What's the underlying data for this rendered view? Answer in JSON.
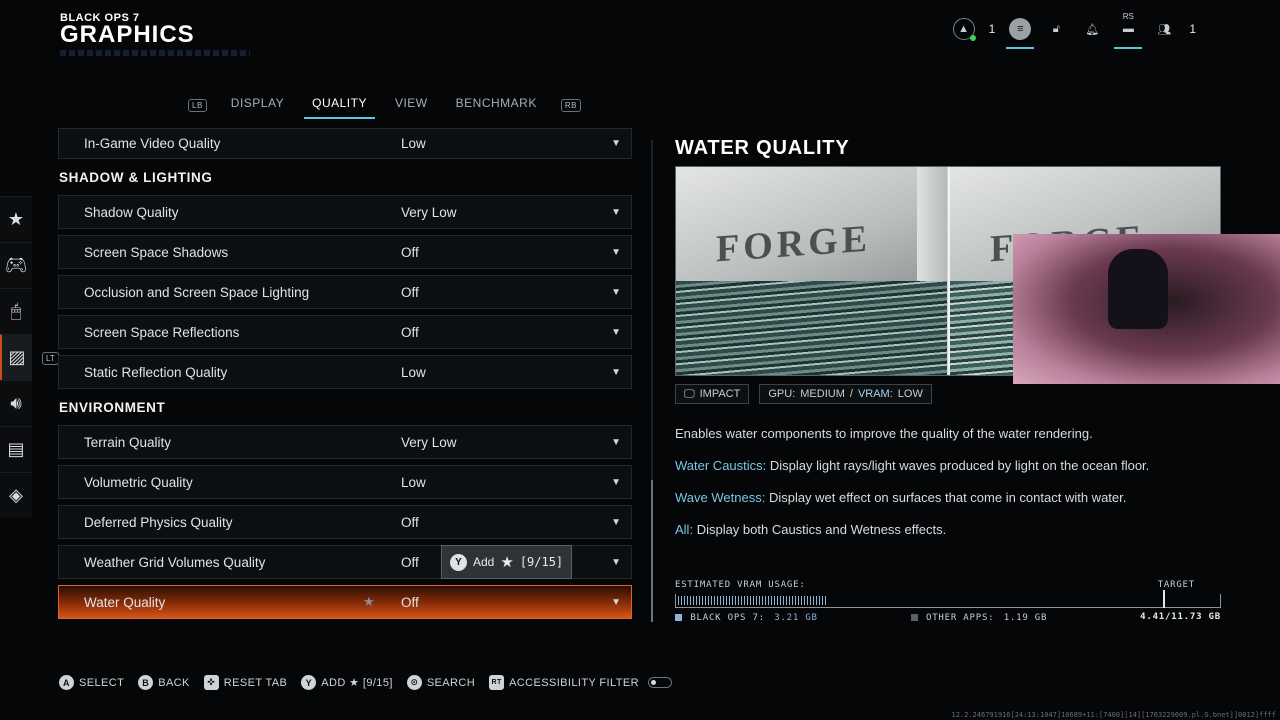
{
  "header": {
    "logo_small": "BLACK OPS 7",
    "title": "GRAPHICS"
  },
  "top_icons": [
    {
      "name": "friends-icon",
      "count": "1"
    },
    {
      "name": "menu-icon"
    },
    {
      "name": "lock-icon"
    },
    {
      "name": "bell-icon"
    },
    {
      "name": "rs-icon",
      "label": "RS"
    },
    {
      "name": "party-icon",
      "count": "1"
    }
  ],
  "tabs": {
    "lb": "LB",
    "rb": "RB",
    "items": [
      "DISPLAY",
      "QUALITY",
      "VIEW",
      "BENCHMARK"
    ],
    "active": "QUALITY"
  },
  "sidebar": {
    "lt": "LT"
  },
  "settings": {
    "top_row": {
      "label": "In-Game Video Quality",
      "value": "Low"
    },
    "sections": [
      {
        "title": "SHADOW & LIGHTING",
        "rows": [
          {
            "label": "Shadow Quality",
            "value": "Very Low"
          },
          {
            "label": "Screen Space Shadows",
            "value": "Off"
          },
          {
            "label": "Occlusion and Screen Space Lighting",
            "value": "Off"
          },
          {
            "label": "Screen Space Reflections",
            "value": "Off"
          },
          {
            "label": "Static Reflection Quality",
            "value": "Low"
          }
        ]
      },
      {
        "title": "ENVIRONMENT",
        "rows": [
          {
            "label": "Terrain Quality",
            "value": "Very Low"
          },
          {
            "label": "Volumetric Quality",
            "value": "Low"
          },
          {
            "label": "Deferred Physics Quality",
            "value": "Off"
          },
          {
            "label": "Weather Grid Volumes Quality",
            "value": "Off"
          },
          {
            "label": "Water Quality",
            "value": "Off"
          }
        ]
      }
    ]
  },
  "tooltip": {
    "button": "Y",
    "label": "Add",
    "count": "[9/15]"
  },
  "detail": {
    "title": "WATER QUALITY",
    "preview_text": "FORGE",
    "impact_label": "IMPACT",
    "gpu_label": "GPU:",
    "gpu_value": "MEDIUM",
    "vram_label": "VRAM:",
    "vram_value": "LOW",
    "description": "Enables water components to improve the quality of the water rendering.",
    "options": [
      {
        "name": "Water Caustics:",
        "text": "Display light rays/light waves produced by light on the ocean floor."
      },
      {
        "name": "Wave Wetness:",
        "text": "Display wet effect on surfaces that come in contact with water."
      },
      {
        "name": "All:",
        "text": "Display both Caustics and Wetness effects."
      }
    ]
  },
  "vram": {
    "label": "ESTIMATED VRAM USAGE:",
    "target_label": "TARGET",
    "game_label": "BLACK OPS 7:",
    "game_value": "3.21 GB",
    "other_label": "OTHER APPS:",
    "other_value": "1.19 GB",
    "total": "4.41/11.73 GB",
    "game_fraction": 0.274,
    "target_fraction": 0.895,
    "colors": {
      "game": "#8fb3d6",
      "other": "#5a6064"
    }
  },
  "footer": {
    "hints": [
      {
        "button": "A",
        "label": "SELECT"
      },
      {
        "button": "B",
        "label": "BACK"
      },
      {
        "button": "✜",
        "label": "RESET TAB"
      },
      {
        "button": "Y",
        "label": "ADD ★ [9/15]"
      },
      {
        "button": "⊙",
        "label": "SEARCH"
      },
      {
        "button": "RT",
        "label": "ACCESSIBILITY FILTER"
      }
    ]
  },
  "build_string": "12.2.246791916[24:13:1047]10689+11:[7400][14][1763229609.pl.G.bnet]]0012]ffff"
}
